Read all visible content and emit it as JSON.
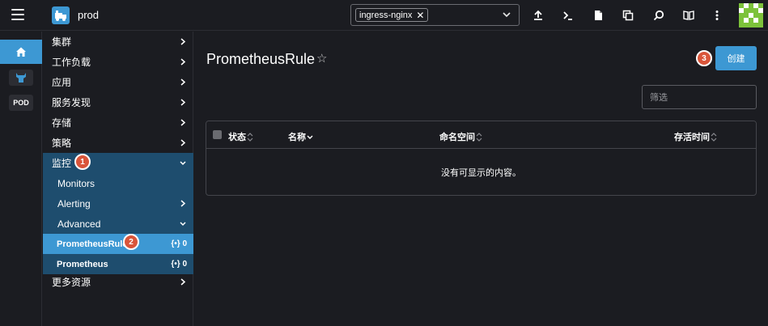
{
  "header": {
    "cluster_name": "prod",
    "namespace_chip": "ingress-nginx",
    "icons": [
      "menu-icon",
      "cluster-logo-icon",
      "upload-icon",
      "terminal-icon",
      "file-icon",
      "copy-icon",
      "search-icon",
      "book-icon",
      "more-vertical-icon",
      "user-avatar"
    ]
  },
  "rail": {
    "items": [
      "home-icon",
      "namespace-icon"
    ],
    "pod_label": "POD"
  },
  "sidenav": {
    "items": [
      {
        "label": "集群"
      },
      {
        "label": "工作负载"
      },
      {
        "label": "应用"
      },
      {
        "label": "服务发现"
      },
      {
        "label": "存储"
      },
      {
        "label": "策略"
      },
      {
        "label": "监控"
      },
      {
        "label": "Monitors"
      },
      {
        "label": "Alerting"
      },
      {
        "label": "Advanced"
      },
      {
        "label": "PrometheusRule",
        "count": "0"
      },
      {
        "label": "Prometheus",
        "count": "0"
      },
      {
        "label": "更多资源"
      }
    ],
    "count_icon": "{•}"
  },
  "main": {
    "title": "PrometheusRule",
    "create_label": "创建",
    "filter_placeholder": "筛选",
    "table": {
      "columns": [
        "状态",
        "名称",
        "命名空间",
        "存活时间"
      ],
      "empty_text": "没有可显示的内容。"
    }
  },
  "annotations": [
    "1",
    "2",
    "3"
  ],
  "colors": {
    "accent": "#3d98d3",
    "nav_open_bg": "#1e4d6e",
    "background": "#1b1c21",
    "badge": "#d9553a"
  }
}
